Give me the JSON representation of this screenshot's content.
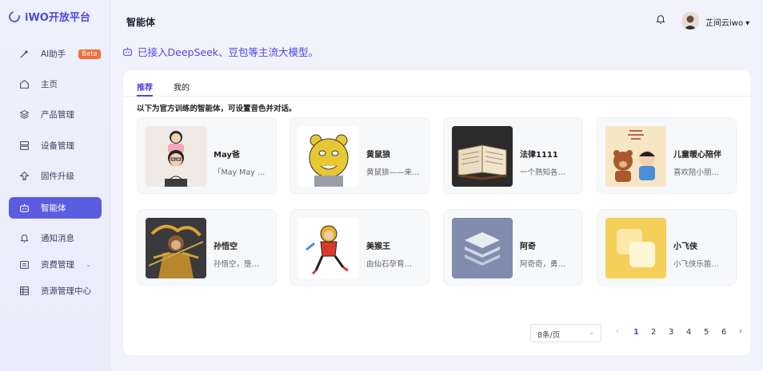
{
  "app": {
    "logo_text": "iWO开放平台"
  },
  "sidebar": {
    "items": [
      {
        "label": "AI助手",
        "badge": "Beta"
      },
      {
        "label": "主页"
      },
      {
        "label": "产品管理"
      },
      {
        "label": "设备管理"
      },
      {
        "label": "固件升级"
      },
      {
        "label": "智能体"
      },
      {
        "label": "通知消息"
      },
      {
        "label": "资费管理"
      },
      {
        "label": "资源管理中心"
      }
    ]
  },
  "header": {
    "title": "智能体",
    "username": "芷间云iwo ▾"
  },
  "banner": {
    "text": "已接入DeepSeek、豆包等主流大模型。"
  },
  "tabs": [
    {
      "label": "推荐"
    },
    {
      "label": "我的"
    }
  ],
  "description": "以下为官方训练的智能体，可设置音色并对话。",
  "agents": [
    {
      "name": "May爸",
      "desc": "「May May …"
    },
    {
      "name": "黄鼠狼",
      "desc": "黄鼠狼——来…"
    },
    {
      "name": "法律1111",
      "desc": "一个熟知各…"
    },
    {
      "name": "儿童暖心陪伴",
      "desc": "喜欢陪小朋…"
    },
    {
      "name": "孙悟空",
      "desc": "孙悟空，堕…"
    },
    {
      "name": "美猴王",
      "desc": "由仙石孕育…"
    },
    {
      "name": "阿奇",
      "desc": "阿奇奇，勇…"
    },
    {
      "name": "小飞侠",
      "desc": "小飞侠乐笛…"
    }
  ],
  "pagination": {
    "page_size": "8条/页",
    "pages": [
      "1",
      "2",
      "3",
      "4",
      "5",
      "6"
    ],
    "current": "1"
  },
  "colors": {
    "accent": "#4f46e5",
    "beta": "#f56c3b"
  }
}
